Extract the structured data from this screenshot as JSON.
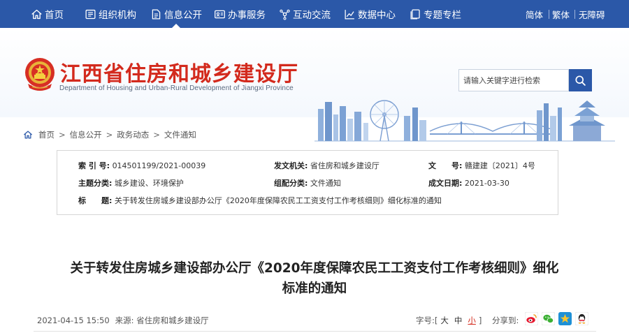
{
  "nav": {
    "items": [
      {
        "label": "首页",
        "icon": "home-icon"
      },
      {
        "label": "组织机构",
        "icon": "org-icon"
      },
      {
        "label": "信息公开",
        "icon": "document-icon",
        "active": true
      },
      {
        "label": "办事服务",
        "icon": "id-card-icon"
      },
      {
        "label": "互动交流",
        "icon": "interaction-icon"
      },
      {
        "label": "数据中心",
        "icon": "chart-icon"
      },
      {
        "label": "专题专栏",
        "icon": "folder-icon"
      }
    ],
    "lang": {
      "simplified": "简体",
      "traditional": "繁体",
      "accessible": "无障碍"
    }
  },
  "header": {
    "title": "江西省住房和城乡建设厅",
    "subtitle": "Department of Housing and Urban-Rural Development of Jiangxi Province",
    "search_placeholder": "请输入关键字进行检索"
  },
  "breadcrumb": {
    "items": [
      "首页",
      "信息公开",
      "政务动态",
      "文件通知"
    ],
    "separator": ">"
  },
  "info": {
    "index_label": "索 引 号:",
    "index_value": "014501199/2021-00039",
    "issuer_label": "发文机关:",
    "issuer_value": "省住房和城乡建设厅",
    "docno_label": "文　　号:",
    "docno_value": "赣建建〔2021〕4号",
    "topic_label": "主题分类:",
    "topic_value": "城乡建设、环境保护",
    "group_label": "组配分类:",
    "group_value": "文件通知",
    "date_label": "成文日期:",
    "date_value": "2021-03-30",
    "title_label": "标　　题:",
    "title_value": "关于转发住房城乡建设部办公厅《2020年度保障农民工工资支付工作考核细则》细化标准的通知"
  },
  "article": {
    "title_line1": "关于转发住房城乡建设部办公厅《2020年度保障农民工工资支付工作考核细则》细化",
    "title_line2": "标准的通知",
    "date": "2021-04-15 15:50",
    "source_label": "来源:",
    "source": "省住房和城乡建设厅",
    "fontsize_label": "字号:",
    "fontsize_open": "[",
    "fontsize_large": "大",
    "fontsize_medium": "中",
    "fontsize_small": "小",
    "fontsize_close": "]",
    "share_label": "分享到:"
  },
  "colors": {
    "nav_bg": "#2b58a8",
    "title_red": "#d32a1d"
  }
}
